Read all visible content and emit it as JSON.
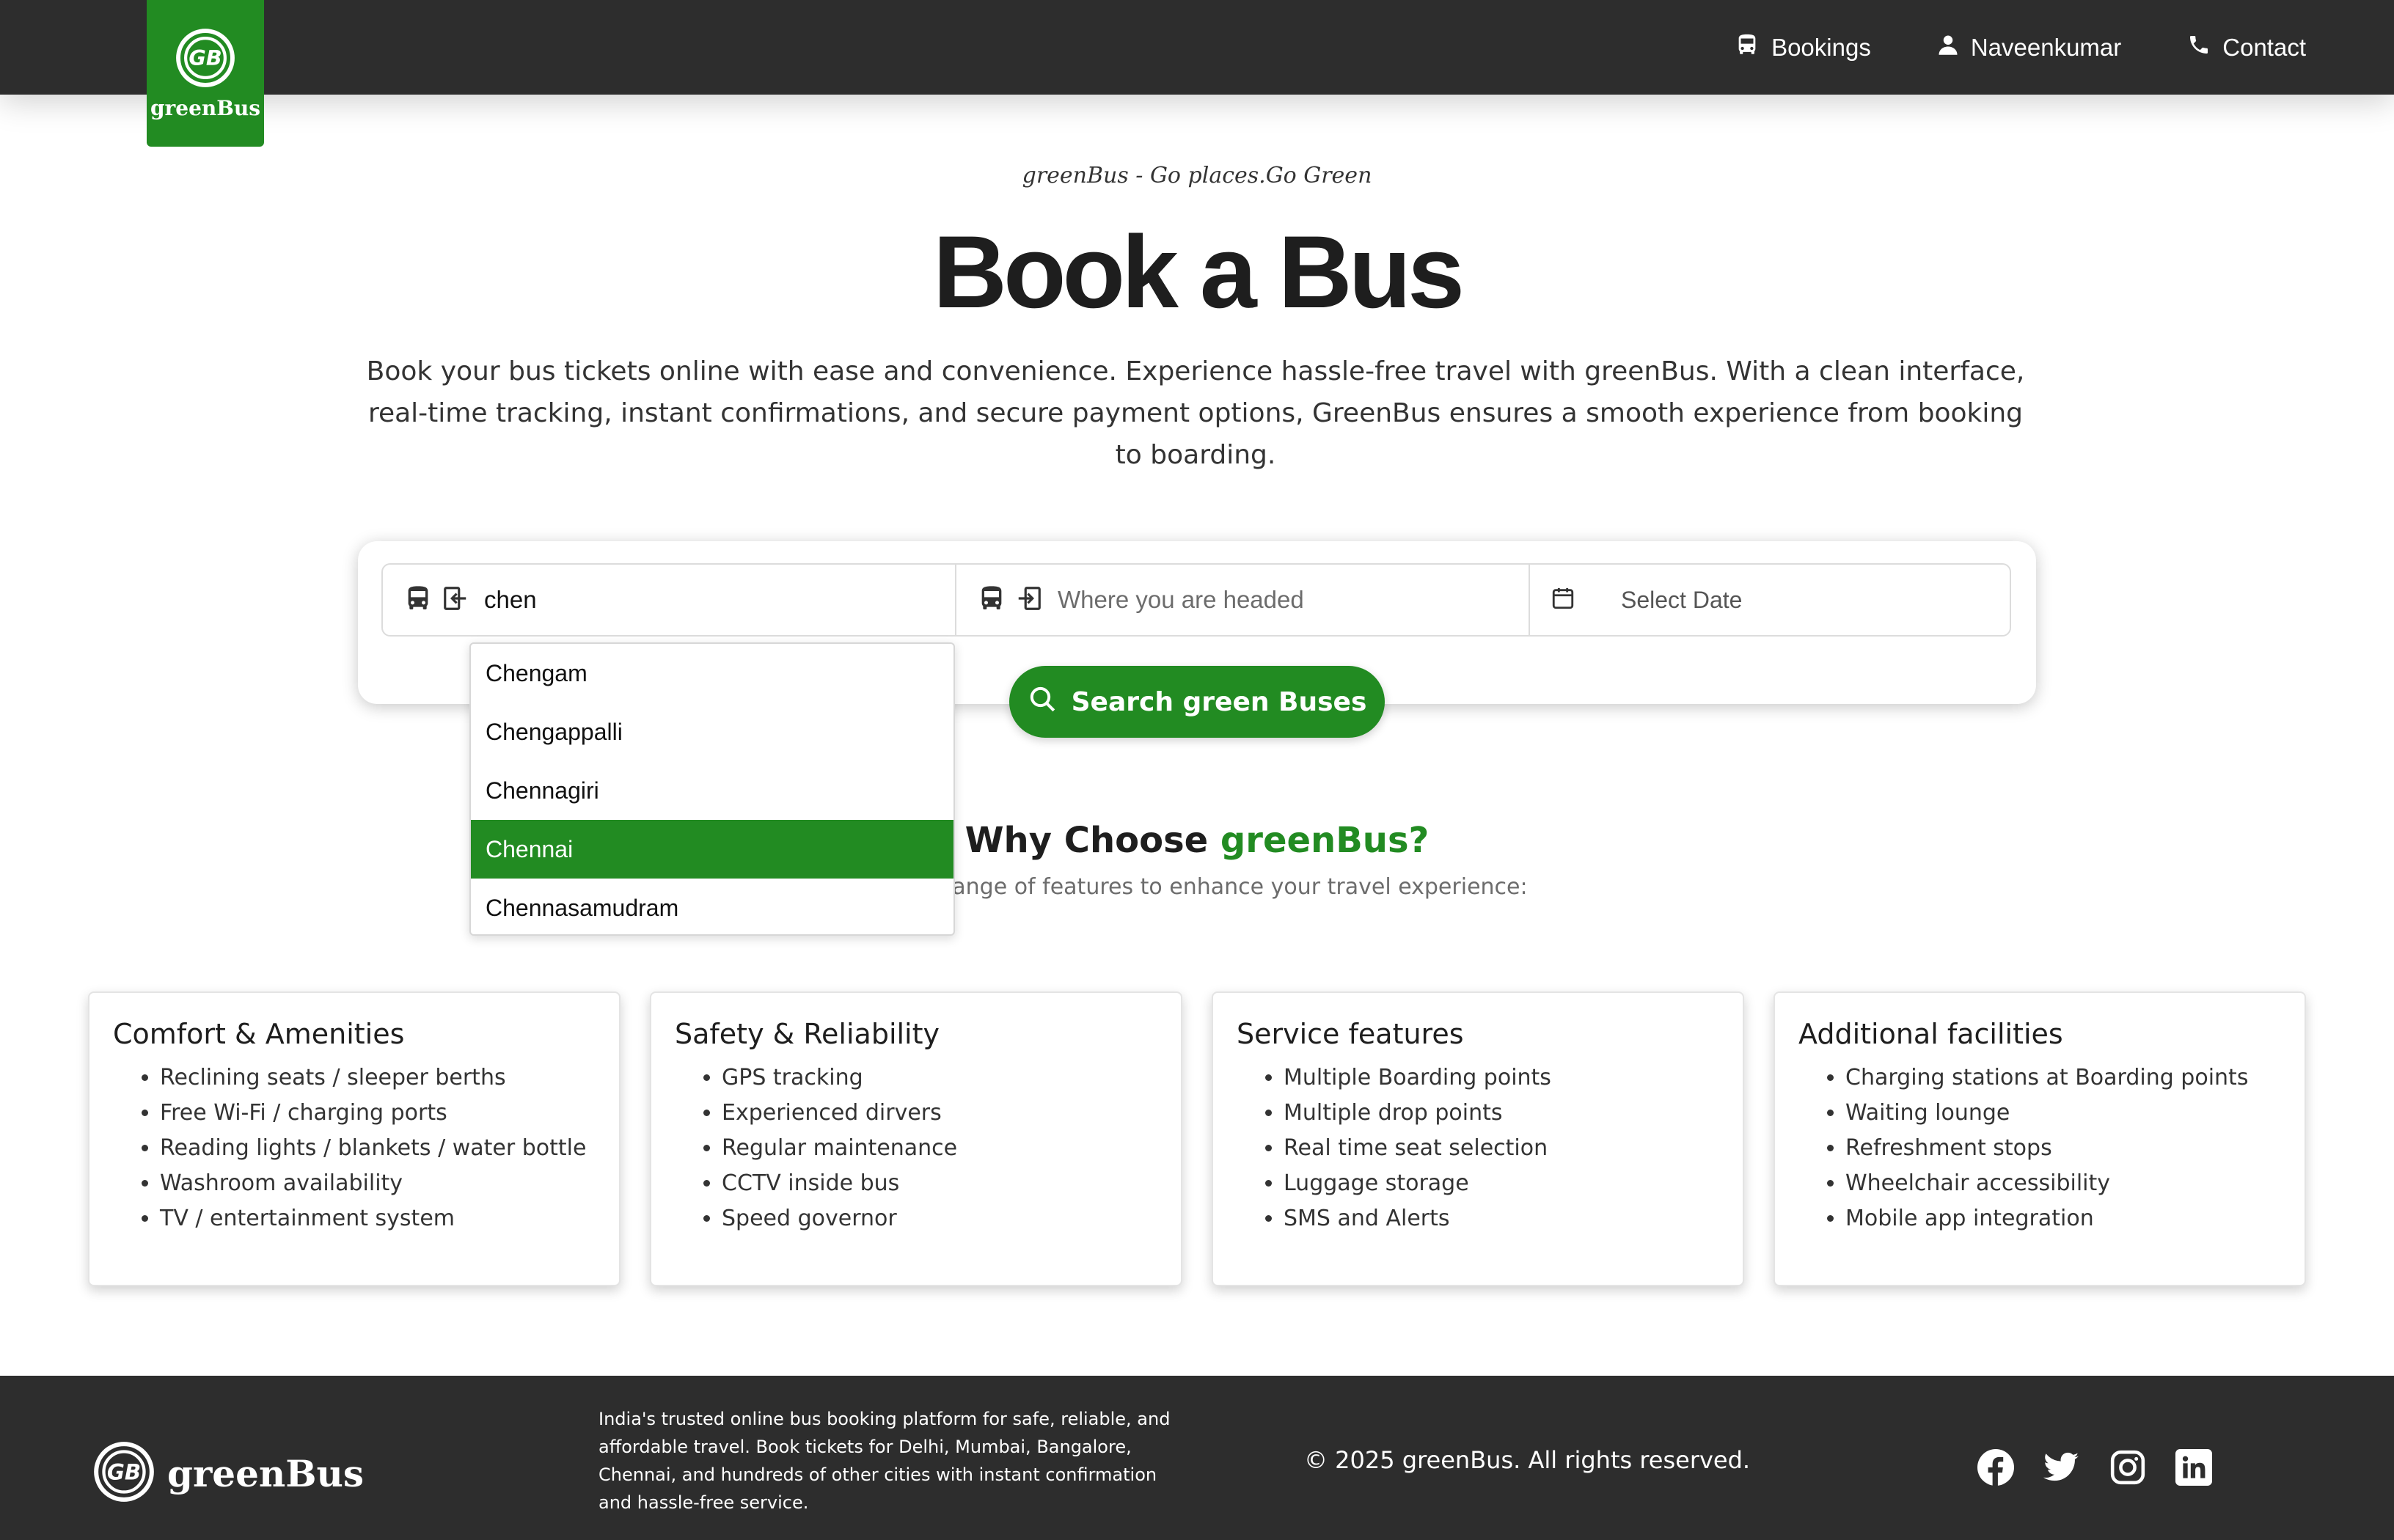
{
  "header": {
    "logo_text": "greenBus",
    "nav": [
      {
        "label": "Bookings",
        "icon": "bus-icon"
      },
      {
        "label": "Naveenkumar",
        "icon": "user-icon"
      },
      {
        "label": "Contact",
        "icon": "phone-icon"
      }
    ]
  },
  "hero": {
    "tagline": "greenBus - Go places.Go Green",
    "title": "Book a Bus",
    "description": "Book your bus tickets online with ease and convenience. Experience hassle-free travel with greenBus. With a clean interface, real-time tracking, instant confirmations, and secure payment options, GreenBus ensures a smooth experience from booking to boarding."
  },
  "search": {
    "from_value": "chen",
    "to_placeholder": "Where you are headed",
    "date_label": "Select Date",
    "button_label": "Search green Buses",
    "suggestions": [
      "Chengam",
      "Chengappalli",
      "Chennagiri",
      "Chennai",
      "Chennasamudram"
    ],
    "active_suggestion": "Chennai"
  },
  "why": {
    "title_prefix": "Why Choose ",
    "title_brand": "greenBus?",
    "subtitle": "ffers a range of features to enhance your travel experience:"
  },
  "features": [
    {
      "title": "Comfort & Amenities",
      "items": [
        "Reclining seats / sleeper berths",
        "Free Wi-Fi / charging ports",
        "Reading lights / blankets / water bottle",
        "Washroom availability",
        "TV / entertainment system"
      ]
    },
    {
      "title": "Safety & Reliability",
      "items": [
        "GPS tracking",
        "Experienced dirvers",
        "Regular maintenance",
        "CCTV inside bus",
        "Speed governor"
      ]
    },
    {
      "title": "Service features",
      "items": [
        "Multiple Boarding points",
        "Multiple drop points",
        "Real time seat selection",
        "Luggage storage",
        "SMS and Alerts"
      ]
    },
    {
      "title": "Additional facilities",
      "items": [
        "Charging stations at Boarding points",
        "Waiting lounge",
        "Refreshment stops",
        "Wheelchair accessibility",
        "Mobile app integration"
      ]
    }
  ],
  "footer": {
    "brand": "greenBus",
    "description": "India's trusted online bus booking platform for safe, reliable, and affordable travel. Book tickets for Delhi, Mumbai, Bangalore, Chennai, and hundreds of other cities with instant confirmation and hassle-free service.",
    "copyright": "© 2025 greenBus. All rights reserved.",
    "socials": [
      "facebook-icon",
      "twitter-icon",
      "instagram-icon",
      "linkedin-icon"
    ]
  },
  "colors": {
    "brand_green": "#228b22",
    "dark_bar": "#2d2d2d"
  }
}
